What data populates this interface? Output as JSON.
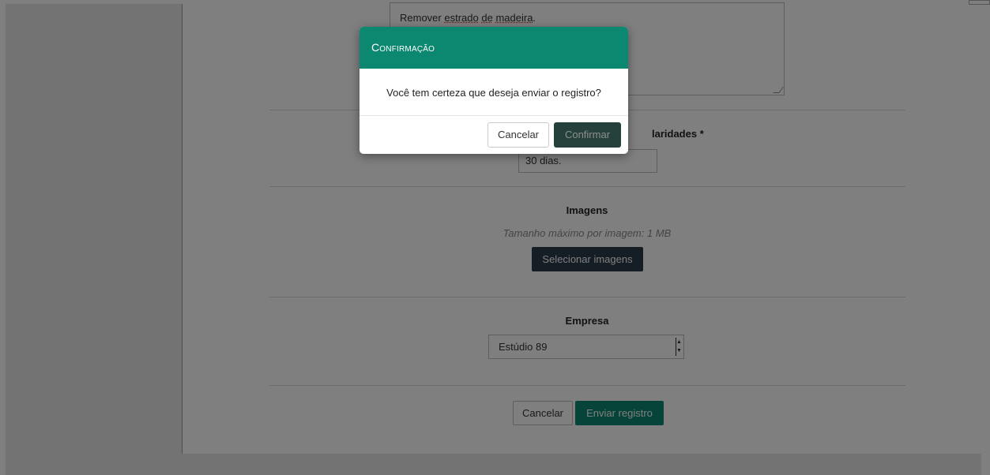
{
  "form": {
    "description_value_before": "Remover ",
    "description_value_w1": "estrado",
    "description_value_sp1": " ",
    "description_value_w2": "de",
    "description_value_sp2": " ",
    "description_value_w3": "madeira",
    "description_value_after": ".",
    "prazo_label_partial": "laridades *",
    "prazo_value": "30 dias.",
    "images_label": "Imagens",
    "images_hint": "Tamanho máximo por imagem: 1 MB",
    "images_button": "Selecionar imagens",
    "company_label": "Empresa",
    "company_selected": "Estúdio 89",
    "cancel_label": "Cancelar",
    "send_label": "Enviar registro"
  },
  "modal": {
    "title": "Confirmação",
    "message": "Você tem certeza que deseja enviar o registro?",
    "cancel_label": "Cancelar",
    "confirm_label": "Confirmar"
  },
  "colors": {
    "accent": "#0c8770",
    "dark_button": "#2b3a4a"
  }
}
